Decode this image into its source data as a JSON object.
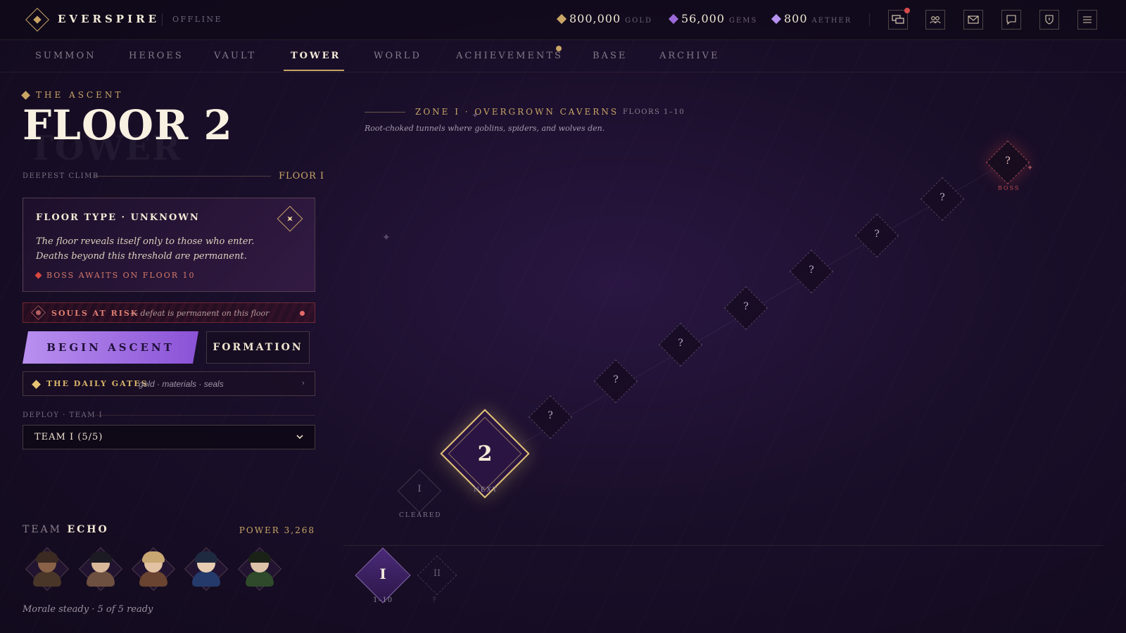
{
  "brand": "EVERSPIRE",
  "status": "OFFLINE",
  "currencies": [
    {
      "amount": "800,000",
      "label": "GOLD",
      "color": "#c9a566"
    },
    {
      "amount": "56,000",
      "label": "GEMS",
      "color": "#9b6ad8"
    },
    {
      "amount": "800",
      "label": "AETHER",
      "color": "#b792f0"
    }
  ],
  "toolbar_icons": [
    "chat-bubbles-icon",
    "friends-icon",
    "mail-icon",
    "message-icon",
    "shield-icon",
    "menu-icon"
  ],
  "nav": [
    "SUMMON",
    "HEROES",
    "VAULT",
    "TOWER",
    "WORLD",
    "ACHIEVEMENTS",
    "BASE",
    "ARCHIVE"
  ],
  "nav_active": "TOWER",
  "left": {
    "ascent_label": "THE ASCENT",
    "floor_title": "FLOOR 2",
    "ghost_text": "TOWER",
    "deepest_label": "DEEPEST CLIMB",
    "deepest_value": "FLOOR I",
    "floor_type": {
      "title": "FLOOR TYPE · UNKNOWN",
      "desc": "The floor reveals itself only to those who enter. Deaths beyond this threshold are permanent.",
      "boss_note": "BOSS AWAITS ON FLOOR 10"
    },
    "risk": {
      "title": "SOULS AT RISK",
      "note": "— defeat is permanent on this floor"
    },
    "begin_label": "BEGIN ASCENT",
    "formation_label": "FORMATION",
    "daily": {
      "title": "THE DAILY GATES",
      "sub": "gold · materials · seals",
      "chevron": "›"
    },
    "deploy_label": "DEPLOY · TEAM I",
    "team_select": "TEAM I (5/5)",
    "team_prefix": "TEAM",
    "team_name": "ECHO",
    "power": "POWER 3,268",
    "morale": "Morale steady · 5 of 5 ready"
  },
  "heroes": [
    {
      "hair": "#3a2a22",
      "skin": "#8a6248",
      "body": "#4a3628"
    },
    {
      "hair": "#1c1a22",
      "skin": "#d9b89a",
      "body": "#6e5040"
    },
    {
      "hair": "#c9a772",
      "skin": "#e2c2a2",
      "body": "#6a4430"
    },
    {
      "hair": "#1e2a40",
      "skin": "#e6cdb2",
      "body": "#243a6a"
    },
    {
      "hair": "#1a2218",
      "skin": "#dcc2a8",
      "body": "#2e4a2a"
    }
  ],
  "map": {
    "zone_title": "ZONE I · OVERGROWN CAVERNS",
    "zone_floors": "FLOORS 1–10",
    "zone_desc": "Root-choked tunnels where goblins, spiders, and wolves den.",
    "cleared_num": "I",
    "cleared_tag": "CLEARED",
    "current_num": "2",
    "current_tag": "NEXT",
    "unknown": "?",
    "boss_tag": "BOSS",
    "zone_tab_1": "I",
    "zone_tab_1_range": "1–10",
    "zone_tab_2": "II",
    "zone_tab_2_lock": "?"
  }
}
